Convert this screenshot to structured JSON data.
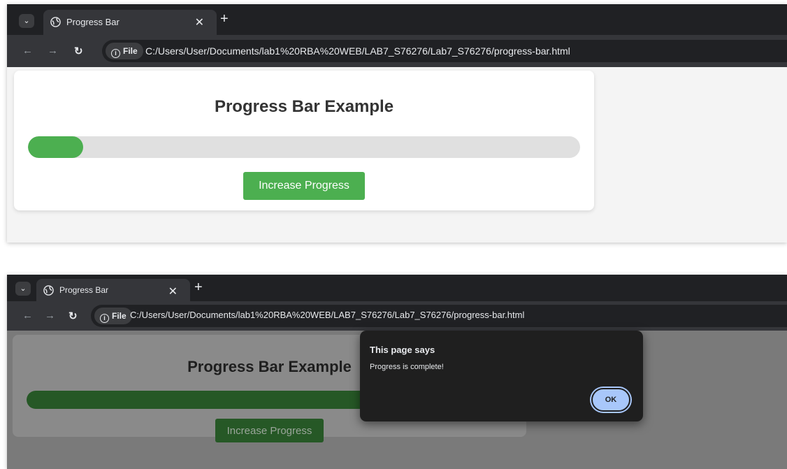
{
  "colors": {
    "accent": "#4caf50",
    "dialog_bg": "#1f1f1f",
    "ok_button": "#a8c7fa"
  },
  "screens": [
    {
      "tab_title": "Progress Bar",
      "address": {
        "chip": "File",
        "url": "C:/Users/User/Documents/lab1%20RBA%20WEB/LAB7_S76276/Lab7_S76276/progress-bar.html"
      },
      "page": {
        "heading": "Progress Bar Example",
        "progress": 0.1,
        "button_label": "Increase Progress"
      }
    },
    {
      "tab_title": "Progress Bar",
      "address": {
        "chip": "File",
        "url": "C:/Users/User/Documents/lab1%20RBA%20WEB/LAB7_S76276/Lab7_S76276/progress-bar.html"
      },
      "page": {
        "heading": "Progress Bar Example",
        "progress": 1.0,
        "button_label": "Increase Progress"
      },
      "dialog": {
        "title": "This page says",
        "message": "Progress is complete!",
        "ok_label": "OK"
      }
    }
  ]
}
